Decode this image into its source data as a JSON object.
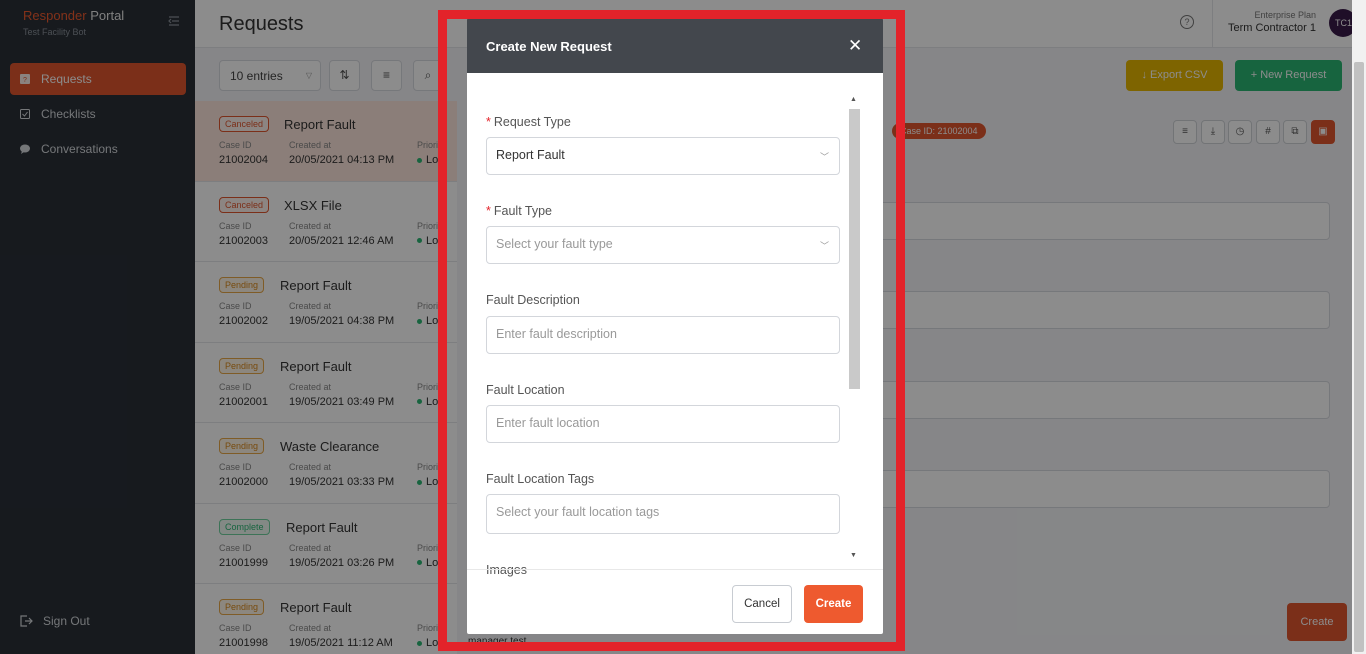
{
  "brand": {
    "name_a": "Responder",
    "name_b": " Portal",
    "sub": "Test Facility Bot"
  },
  "nav": [
    {
      "label": "Requests"
    },
    {
      "label": "Checklists"
    },
    {
      "label": "Conversations"
    }
  ],
  "signout": "Sign Out",
  "header": {
    "title": "Requests",
    "plan": "Enterprise Plan",
    "user": "Term Contractor 1",
    "avatar": "TC1"
  },
  "toolbar": {
    "entries": "10 entries",
    "export": "↓  Export CSV",
    "new": "+  New Request"
  },
  "requests": [
    {
      "status": "Canceled",
      "title": "Report Fault",
      "case_label": "Case ID",
      "case_id": "21002004",
      "created_label": "Created at",
      "created": "20/05/2021 04:13 PM",
      "prio_label": "Priority",
      "prio": "Low"
    },
    {
      "status": "Canceled",
      "title": "XLSX File",
      "case_label": "Case ID",
      "case_id": "21002003",
      "created_label": "Created at",
      "created": "20/05/2021 12:46 AM",
      "prio_label": "Priority",
      "prio": "Low"
    },
    {
      "status": "Pending",
      "title": "Report Fault",
      "case_label": "Case ID",
      "case_id": "21002002",
      "created_label": "Created at",
      "created": "19/05/2021 04:38 PM",
      "prio_label": "Priority",
      "prio": "Low"
    },
    {
      "status": "Pending",
      "title": "Report Fault",
      "case_label": "Case ID",
      "case_id": "21002001",
      "created_label": "Created at",
      "created": "19/05/2021 03:49 PM",
      "prio_label": "Priority",
      "prio": "Low"
    },
    {
      "status": "Pending",
      "title": "Waste Clearance",
      "case_label": "Case ID",
      "case_id": "21002000",
      "created_label": "Created at",
      "created": "19/05/2021 03:33 PM",
      "prio_label": "Priority",
      "prio": "Low"
    },
    {
      "status": "Complete",
      "title": "Report Fault",
      "case_label": "Case ID",
      "case_id": "21001999",
      "created_label": "Created at",
      "created": "19/05/2021 03:26 PM",
      "prio_label": "Priority",
      "prio": "Low"
    },
    {
      "status": "Pending",
      "title": "Report Fault",
      "case_label": "Case ID",
      "case_id": "21001998",
      "created_label": "Created at",
      "created": "19/05/2021 11:12 AM",
      "prio_label": "Priority",
      "prio": "Low"
    }
  ],
  "detail": {
    "title_tail": "t",
    "case_tag": "Case ID: 21002004",
    "create": "Create",
    "assignee": "manager test"
  },
  "modal": {
    "title": "Create New Request",
    "close": "✕",
    "request_type_label": "Request Type",
    "request_type_value": "Report Fault",
    "fault_type_label": "Fault Type",
    "fault_type_placeholder": "Select your fault type",
    "fault_desc_label": "Fault Description",
    "fault_desc_placeholder": "Enter fault description",
    "fault_loc_label": "Fault Location",
    "fault_loc_placeholder": "Enter fault location",
    "fault_tags_label": "Fault Location Tags",
    "fault_tags_placeholder": "Select your fault location tags",
    "images_label": "Images",
    "cancel": "Cancel",
    "create": "Create"
  }
}
